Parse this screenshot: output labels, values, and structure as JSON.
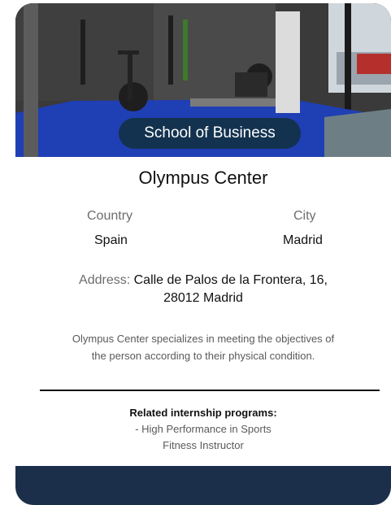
{
  "card": {
    "badge": "School of Business",
    "title": "Olympus Center",
    "country_label": "Country",
    "country_value": "Spain",
    "city_label": "City",
    "city_value": "Madrid",
    "address_label": "Address:",
    "address_line1": "Calle de Palos de la Frontera, 16,",
    "address_line2": "28012 Madrid",
    "description_line1": "Olympus Center specializes in meeting the objectives of",
    "description_line2": "the person according to their physical condition.",
    "programs_heading": "Related internship programs:",
    "programs": [
      "- High Performance in Sports",
      "Fitness Instructor"
    ]
  },
  "colors": {
    "badge_bg": "#13324f",
    "footer_bg": "#1b2f4a",
    "floor": "#1f3fb5"
  }
}
